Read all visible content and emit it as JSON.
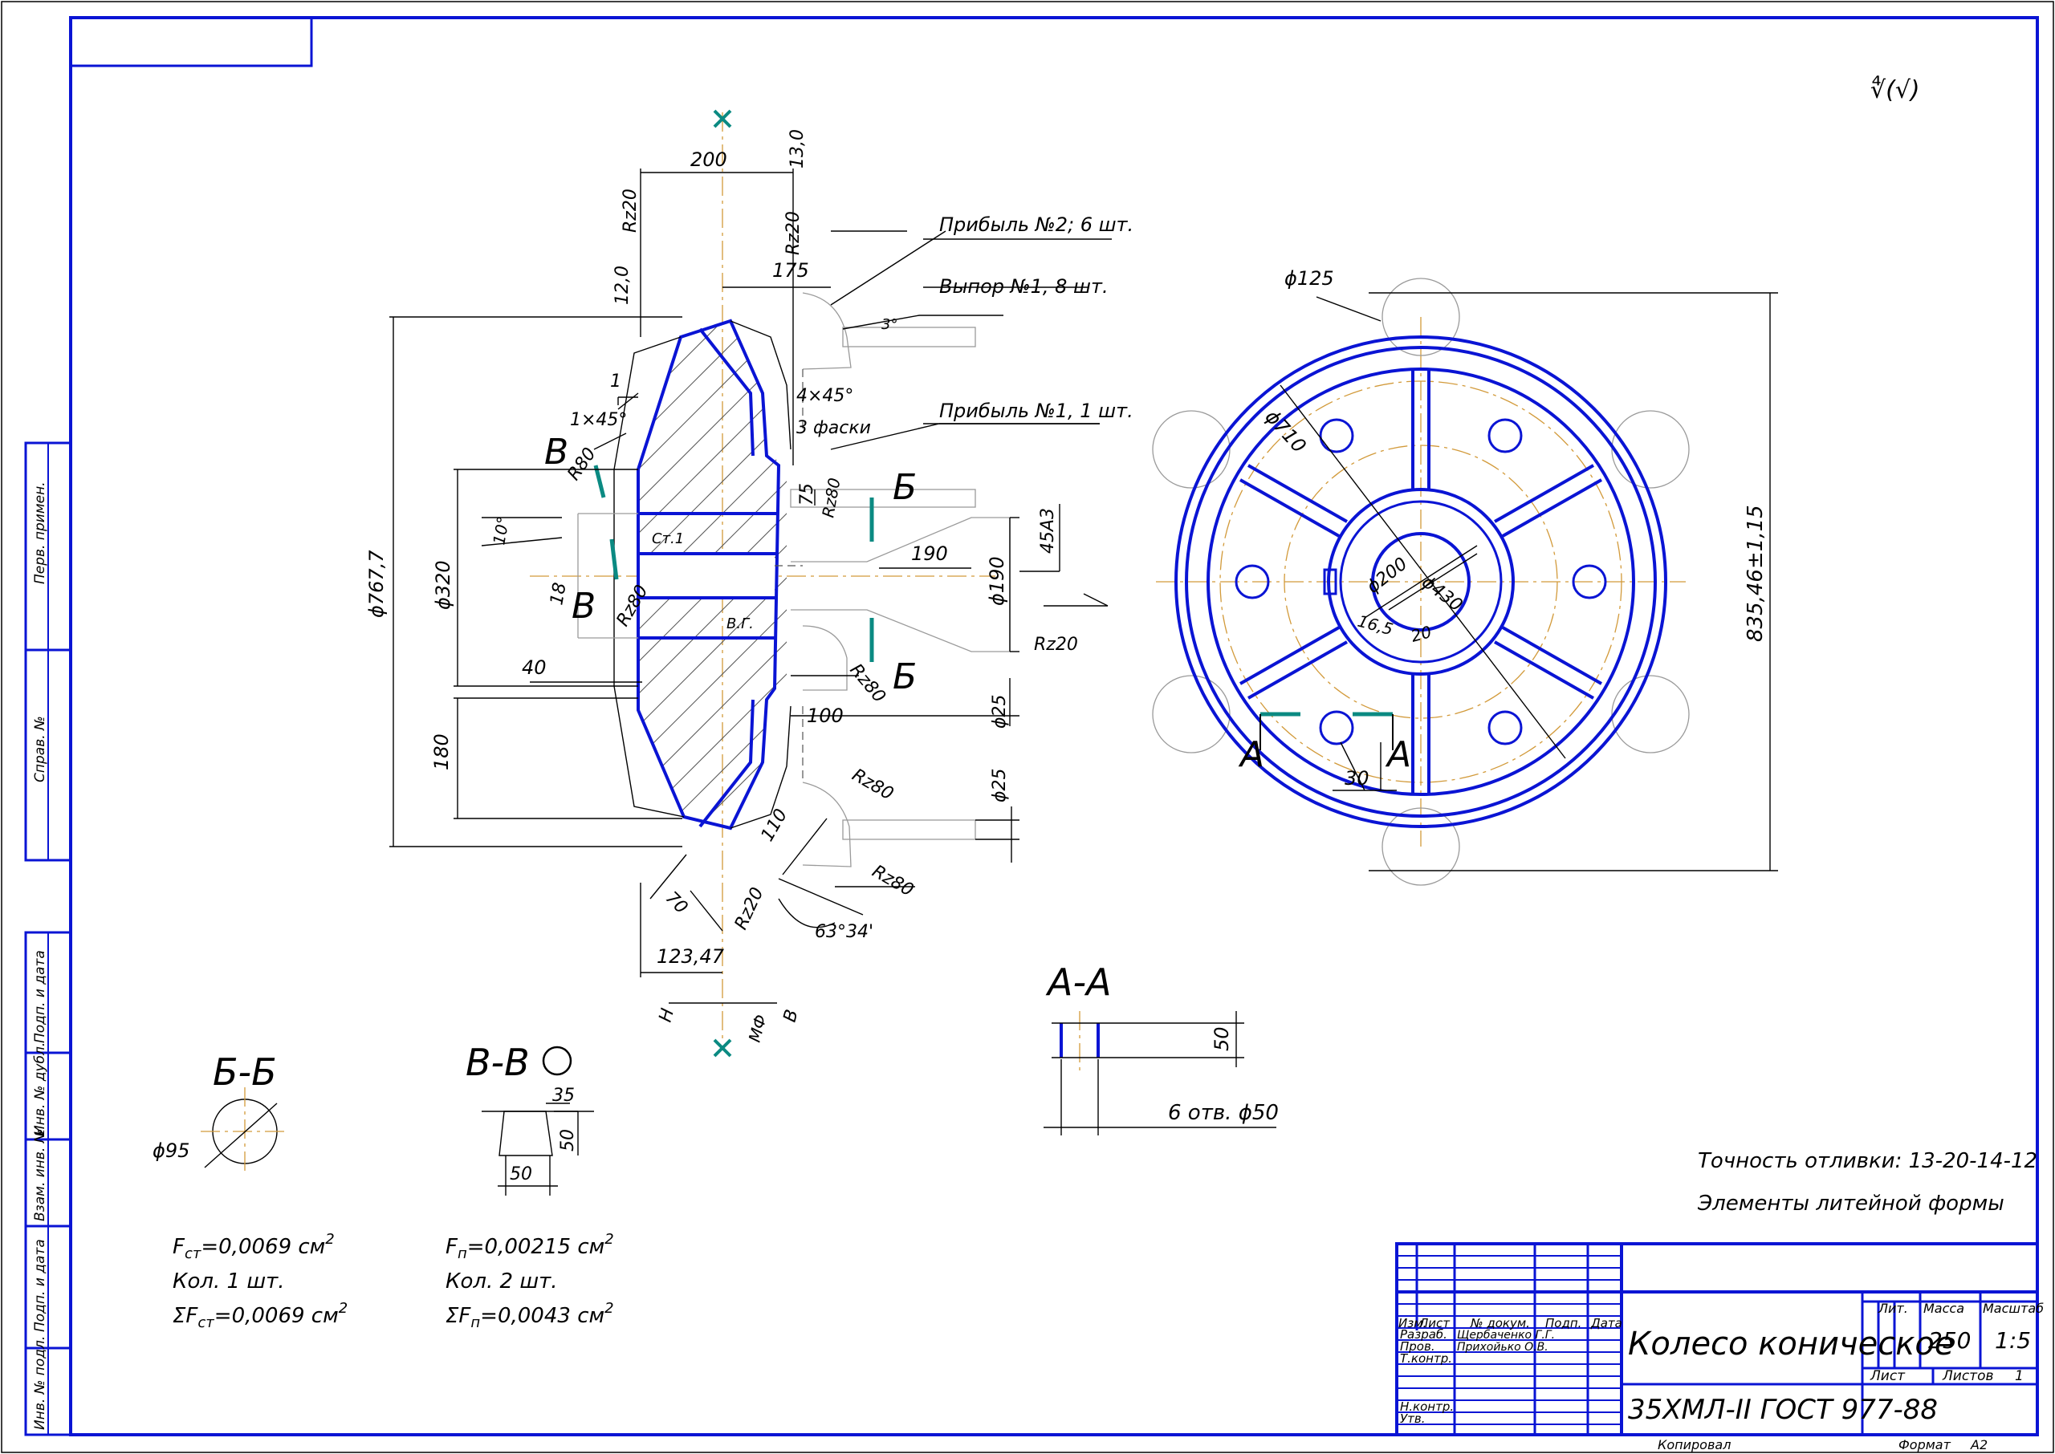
{
  "part_title": "Колесо коническое",
  "material": "35ХМЛ-II ГОСТ 977-88",
  "roughness_mark": "∜(√)",
  "notes": {
    "casting_accuracy": "Точность отливки: 13-20-14-12",
    "mold_elements": "Элементы литейной формы"
  },
  "left_strip": [
    "Перв. примен.",
    "Справ. №",
    "Подп. и дата",
    "Инв. № дубл.",
    "Взам. инв. №",
    "Подп. и дата",
    "Инв. № подл."
  ],
  "title_block": {
    "col_headers": [
      "Изм.",
      "Лист",
      "№ докум.",
      "Подп.",
      "Дата"
    ],
    "rows": [
      {
        "role": "Разраб.",
        "name": "Щербаченко Г.Г."
      },
      {
        "role": "Пров.",
        "name": "Прихойько О.В."
      },
      {
        "role": "Т.контр.",
        "name": ""
      },
      {
        "role": "Н.контр.",
        "name": ""
      },
      {
        "role": "Утв.",
        "name": ""
      }
    ],
    "lit_label": "Лит.",
    "mass_label": "Масса",
    "scale_label": "Масштаб",
    "mass_value": "250",
    "scale_value": "1:5",
    "sheet_label": "Лист",
    "sheets_label": "Листов",
    "sheets_value": "1",
    "copied_label": "Копировал",
    "format_label": "Формат",
    "format_value": "А2"
  },
  "section_view": {
    "dims": {
      "d200": "200",
      "d13": "13,0",
      "rz220a": "Rz20",
      "rz220b": "Rz20",
      "d12": "12,0",
      "d175": "175",
      "d1": "1",
      "chamfer1": "1×45°",
      "chamfer4": "4×45°",
      "chamfers3": "3 фаски",
      "dia767": "ϕ767,7",
      "dia320": "ϕ320",
      "r80": "R80",
      "ang10": "10°",
      "v18": "18",
      "d40": "40",
      "d180": "180",
      "d75": "75",
      "rz80a": "Rz80",
      "d190": "190",
      "dia190": "ϕ190",
      "tol45": "45А3",
      "rz20c": "Rz20",
      "rz80b": "Rz80",
      "d100": "100",
      "dia25a": "ϕ25",
      "dia25b": "ϕ25",
      "rz80c": "Rz80",
      "d110": "110",
      "rz80d": "Rz80",
      "d70": "70",
      "rz20d": "Rz20",
      "ang63": "63°34'",
      "d12347": "123,47",
      "ang3": "3°",
      "st1": "Ст.1",
      "vg": "В.Г.",
      "letter_n": "Н",
      "letter_v": "В",
      "mf": "МФ"
    },
    "labels": {
      "riser2": "Прибыль №2; 6 шт.",
      "vent1": "Выпор №1, 8 шт.",
      "riser1": "Прибыль №1, 1 шт."
    },
    "cut_letters": {
      "b_top": "Б",
      "b_bot": "Б",
      "v_top": "В",
      "v_bot": "В"
    }
  },
  "plan_view": {
    "dims": {
      "dia125": "ϕ125",
      "dia710": "ϕ710",
      "dia200": "ϕ200",
      "dia430": "ϕ430",
      "d16_5": "16,5",
      "d20": "20",
      "d30": "30",
      "overall": "835,46±1,15"
    },
    "cut_letters": {
      "a_left": "А",
      "a_right": "А"
    }
  },
  "section_bb": {
    "title": "Б-Б",
    "dia": "ϕ95",
    "f": "F",
    "f_sub": "ст",
    "f_val": "=0,0069 см",
    "f_exp": "2",
    "qty": "Кол. 1 шт.",
    "sum": "ΣF",
    "sum_sub": "ст",
    "sum_val": "=0,0069 см",
    "sum_exp": "2"
  },
  "section_vv": {
    "title": "В-В",
    "d35": "35",
    "d50a": "50",
    "d50b": "50",
    "f": "F",
    "f_sub": "п",
    "f_val": "=0,00215 см",
    "f_exp": "2",
    "qty": "Кол. 2 шт.",
    "sum": "ΣF",
    "sum_sub": "п",
    "sum_val": "=0,0043 см",
    "sum_exp": "2"
  },
  "section_aa": {
    "title": "А-А",
    "d50": "50",
    "holes": "6 отв. ϕ50"
  }
}
